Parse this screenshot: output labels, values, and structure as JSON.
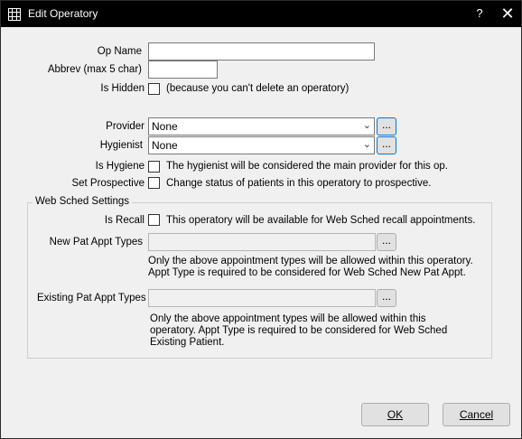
{
  "window": {
    "title": "Edit Operatory",
    "help_label": "?",
    "close_label": "✕"
  },
  "fields": {
    "op_name_label": "Op Name",
    "op_name_value": "",
    "abbrev_label": "Abbrev (max 5 char)",
    "abbrev_value": "",
    "is_hidden_label": "Is Hidden",
    "is_hidden_checked": false,
    "is_hidden_note": "(because you can't delete an operatory)",
    "provider_label": "Provider",
    "provider_value": "None",
    "hygienist_label": "Hygienist",
    "hygienist_value": "None",
    "is_hygiene_label": "Is Hygiene",
    "is_hygiene_note": "The hygienist will be considered the main provider for this op.",
    "set_prospective_label": "Set Prospective",
    "set_prospective_note": "Change status of patients in this operatory to prospective.",
    "ellipsis": "..."
  },
  "web_sched": {
    "group_title": "Web Sched Settings",
    "is_recall_label": "Is Recall",
    "is_recall_note": "This operatory will be available for Web Sched recall appointments.",
    "new_pat_label": "New Pat Appt Types",
    "new_pat_value": "",
    "new_pat_note_1": "Only the above appointment types will be allowed within this operatory.",
    "new_pat_note_2": "Appt Type is required to be considered for Web Sched New Pat Appt.",
    "existing_pat_label": "Existing Pat Appt Types",
    "existing_pat_value": "",
    "existing_pat_note_1": "Only the above appointment types will be allowed within this",
    "existing_pat_note_2": "operatory.  Appt Type is required to be considered for Web Sched",
    "existing_pat_note_3": "Existing Patient."
  },
  "buttons": {
    "ok_label": "OK",
    "cancel_label": "Cancel"
  },
  "icons": {
    "app": "grid-app-icon",
    "dropdown": "chevron-down-icon"
  },
  "colors": {
    "titlebar": "#000000",
    "dialog_bg": "#f0f0f0",
    "focus_border": "#0078d7"
  }
}
